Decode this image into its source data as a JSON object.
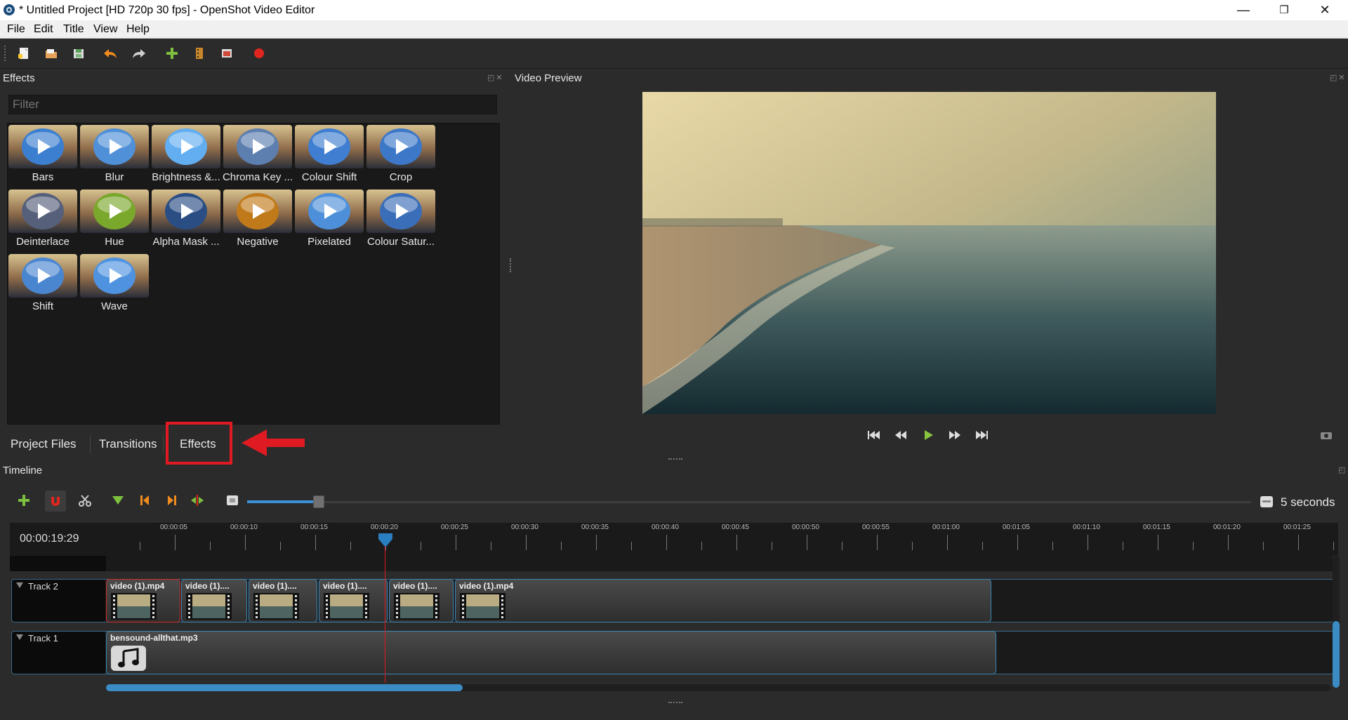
{
  "window": {
    "title": "* Untitled Project [HD 720p 30 fps] - OpenShot Video Editor",
    "minimize": "—",
    "maximize": "❐",
    "close": "✕"
  },
  "menu": {
    "file": "File",
    "edit": "Edit",
    "title": "Title",
    "view": "View",
    "help": "Help"
  },
  "toolbar": {
    "icons": [
      "new-project-icon",
      "open-project-icon",
      "save-project-icon",
      "undo-icon",
      "redo-icon",
      "import-files-icon",
      "profile-icon",
      "fullscreen-icon",
      "export-video-icon"
    ]
  },
  "effects_panel": {
    "title": "Effects",
    "filter_placeholder": "Filter",
    "items": [
      {
        "label": "Bars",
        "hue": "#3c7fd0"
      },
      {
        "label": "Blur",
        "hue": "#4f90d8"
      },
      {
        "label": "Brightness &...",
        "hue": "#62aef0"
      },
      {
        "label": "Chroma Key ...",
        "hue": "#5d7fb0"
      },
      {
        "label": "Colour Shift",
        "hue": "#3f7ed0"
      },
      {
        "label": "Crop",
        "hue": "#3d78c8"
      },
      {
        "label": "Deinterlace",
        "hue": "#56607a"
      },
      {
        "label": "Hue",
        "hue": "#7aa82c"
      },
      {
        "label": "Alpha Mask ...",
        "hue": "#2a4e84"
      },
      {
        "label": "Negative",
        "hue": "#c07a1a"
      },
      {
        "label": "Pixelated",
        "hue": "#4d8fd8"
      },
      {
        "label": "Colour Satur...",
        "hue": "#3b6eb8"
      },
      {
        "label": "Shift",
        "hue": "#4a86d0"
      },
      {
        "label": "Wave",
        "hue": "#4f93e0"
      }
    ]
  },
  "tabs": {
    "project_files": "Project Files",
    "transitions": "Transitions",
    "effects": "Effects"
  },
  "preview": {
    "title": "Video Preview"
  },
  "timeline": {
    "title": "Timeline",
    "zoom_label": "5 seconds",
    "current_time": "00:00:19:29",
    "ruler_labels": [
      "00:00:05",
      "00:00:10",
      "00:00:15",
      "00:00:20",
      "00:00:25",
      "00:00:30",
      "00:00:35",
      "00:00:40",
      "00:00:45",
      "00:00:50",
      "00:00:55",
      "00:01:00",
      "00:01:05",
      "00:01:10",
      "00:01:15",
      "00:01:20",
      "00:01:25"
    ],
    "tracks": [
      {
        "name": "Track 2",
        "clips": [
          "video (1).mp4",
          "video (1)....",
          "video (1)....",
          "video (1)....",
          "video (1)....",
          "video (1).mp4"
        ]
      },
      {
        "name": "Track 1",
        "clips": [
          "bensound-allthat.mp3"
        ]
      }
    ]
  },
  "colors": {
    "accent": "#3d8fd6",
    "highlight": "#e01a22",
    "play": "#8ac33f"
  }
}
